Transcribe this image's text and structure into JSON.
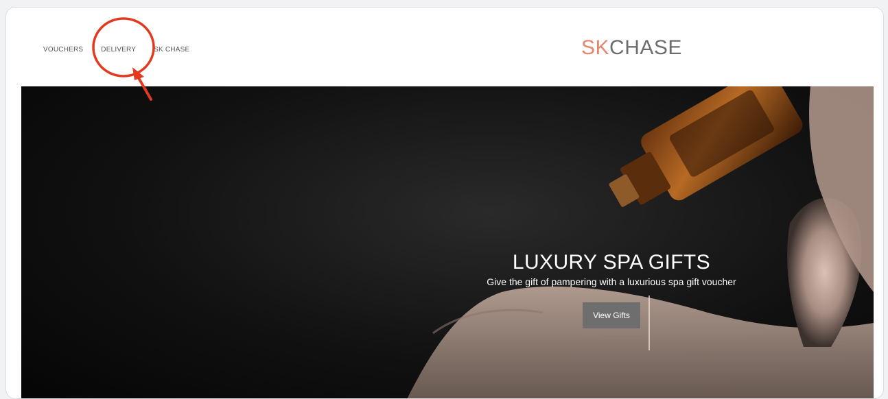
{
  "nav": {
    "items": [
      {
        "label": "VOUCHERS"
      },
      {
        "label": "DELIVERY"
      },
      {
        "label": "SK CHASE"
      }
    ]
  },
  "logo": {
    "part1": "SK",
    "part2": "CHASE"
  },
  "hero": {
    "title": "LUXURY SPA GIFTS",
    "subtitle": "Give the gift of pampering with a luxurious spa gift voucher",
    "button_label": "View Gifts"
  },
  "colors": {
    "accent": "#e8836f",
    "annotation": "#e23a1e",
    "button": "#6e6e6e"
  }
}
